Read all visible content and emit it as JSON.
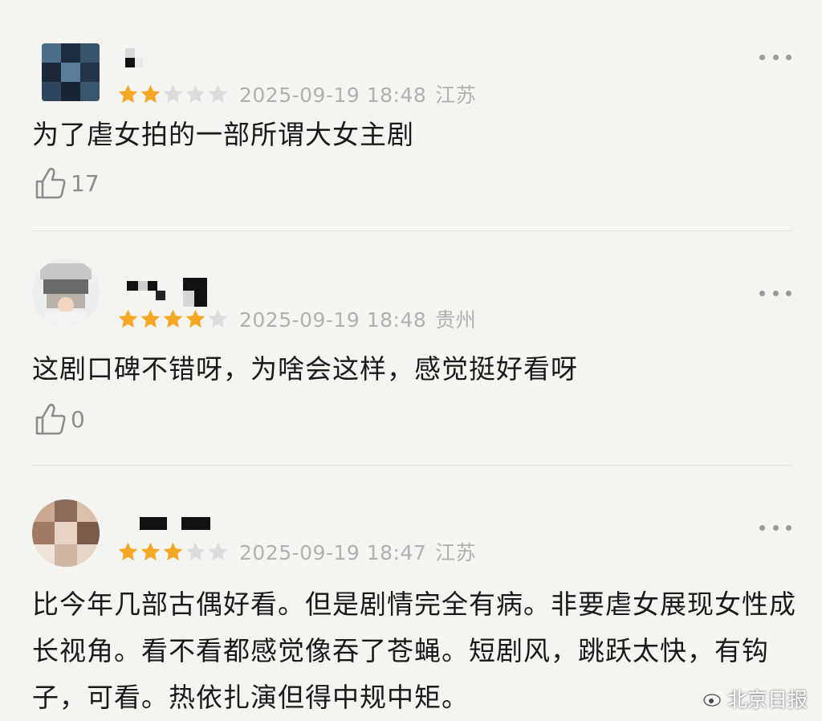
{
  "comments": [
    {
      "rating": 2,
      "date": "2025-09-19 18:48",
      "location": "江苏",
      "text": "为了虐女拍的一部所谓大女主剧",
      "likes": "17"
    },
    {
      "rating": 4,
      "date": "2025-09-19 18:48",
      "location": "贵州",
      "text": "这剧口碑不错呀，为啥会这样，感觉挺好看呀",
      "likes": "0"
    },
    {
      "rating": 3,
      "date": "2025-09-19 18:47",
      "location": "江苏",
      "text": "比今年几部古偶好看。但是剧情完全有病。非要虐女展现女性成长视角。看不看都感觉像吞了苍蝇。短剧风，跳跃太快，有钩子，可看。热依扎演但得中规中矩。",
      "likes": ""
    }
  ],
  "watermark": "北京日报",
  "icons": {
    "more": "more-icon",
    "like": "thumbs-up-icon",
    "star": "star-icon",
    "weibo": "weibo-icon"
  },
  "colors": {
    "background": "#f6f4f1",
    "star_filled": "#f5a623",
    "star_empty": "#dcdcdc",
    "meta_text": "#b0b0b0",
    "divider": "#e3e0db"
  }
}
